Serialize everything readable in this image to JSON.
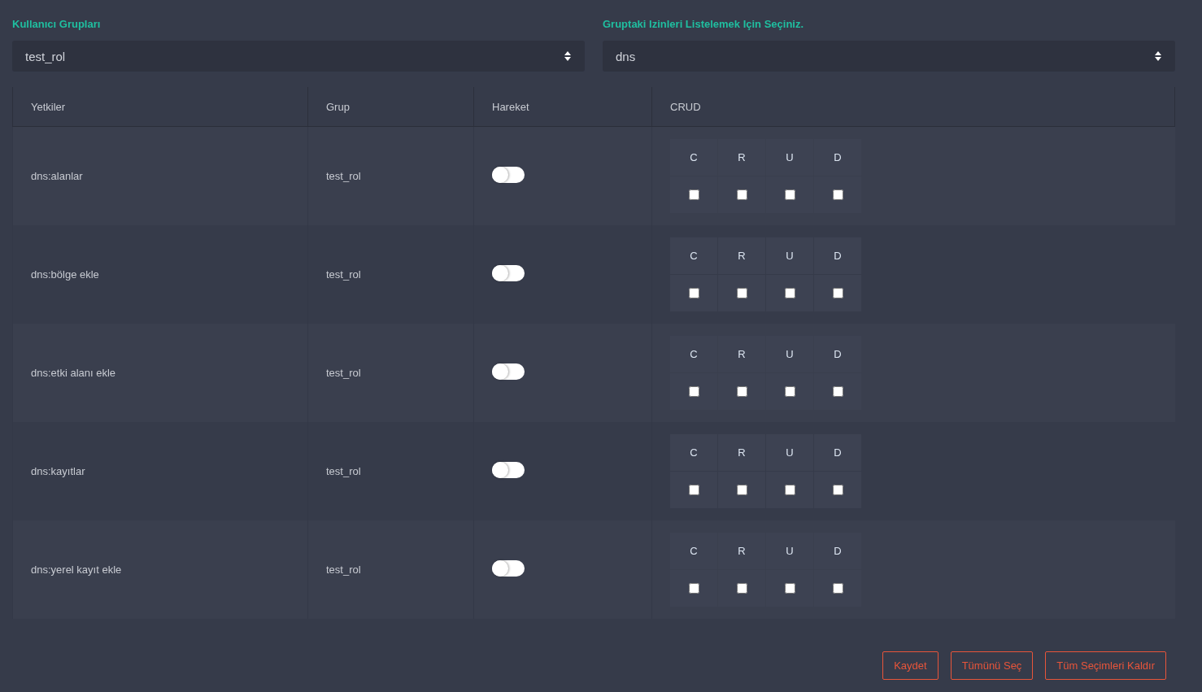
{
  "user_groups": {
    "label": "Kullanıcı Grupları",
    "value": "test_rol"
  },
  "permission_group": {
    "label": "Gruptaki Izinleri Listelemek Için Seçiniz.",
    "value": "dns"
  },
  "table": {
    "columns": [
      "Yetkiler",
      "Grup",
      "Hareket",
      "CRUD"
    ],
    "rows": [
      {
        "permission": "dns:alanlar",
        "group": "test_rol",
        "action_on": false,
        "crud": [
          {
            "letter": "C",
            "checked": false
          },
          {
            "letter": "R",
            "checked": false
          },
          {
            "letter": "U",
            "checked": false
          },
          {
            "letter": "D",
            "checked": false
          }
        ]
      },
      {
        "permission": "dns:bölge ekle",
        "group": "test_rol",
        "action_on": false,
        "crud": [
          {
            "letter": "C",
            "checked": false
          },
          {
            "letter": "R",
            "checked": false
          },
          {
            "letter": "U",
            "checked": false
          },
          {
            "letter": "D",
            "checked": false
          }
        ]
      },
      {
        "permission": "dns:etki alanı ekle",
        "group": "test_rol",
        "action_on": false,
        "crud": [
          {
            "letter": "C",
            "checked": false
          },
          {
            "letter": "R",
            "checked": false
          },
          {
            "letter": "U",
            "checked": false
          },
          {
            "letter": "D",
            "checked": false
          }
        ]
      },
      {
        "permission": "dns:kayıtlar",
        "group": "test_rol",
        "action_on": false,
        "crud": [
          {
            "letter": "C",
            "checked": false
          },
          {
            "letter": "R",
            "checked": false
          },
          {
            "letter": "U",
            "checked": false
          },
          {
            "letter": "D",
            "checked": false
          }
        ]
      },
      {
        "permission": "dns:yerel kayıt ekle",
        "group": "test_rol",
        "action_on": false,
        "crud": [
          {
            "letter": "C",
            "checked": false
          },
          {
            "letter": "R",
            "checked": false
          },
          {
            "letter": "U",
            "checked": false
          },
          {
            "letter": "D",
            "checked": false
          }
        ]
      }
    ]
  },
  "buttons": [
    "Kaydet",
    "Tümünü Seç",
    "Tüm Seçimleri Kaldır"
  ]
}
